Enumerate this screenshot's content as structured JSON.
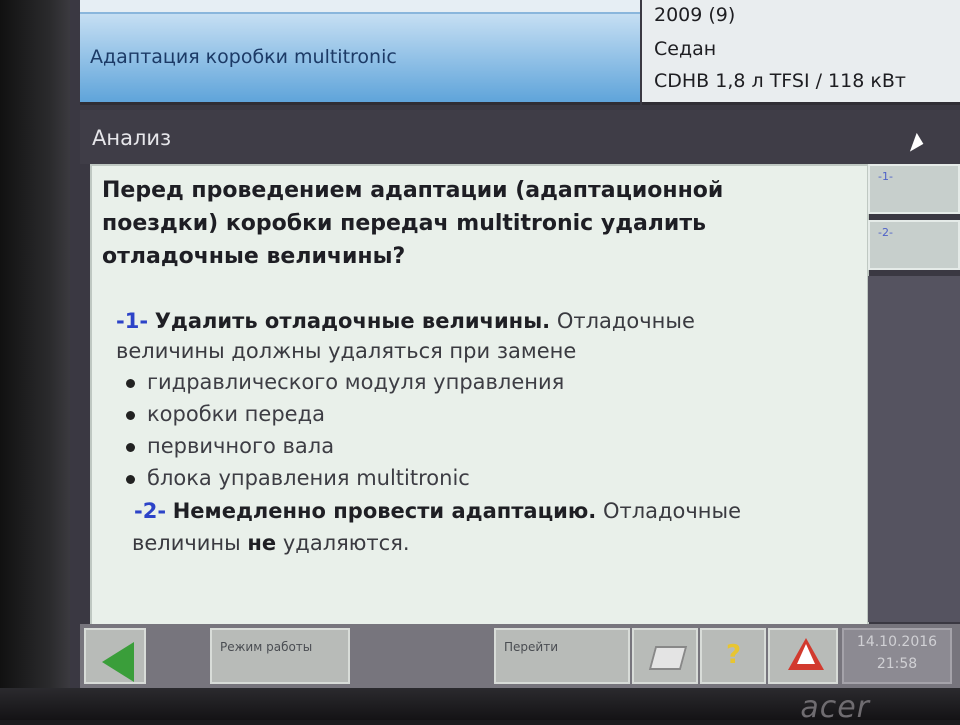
{
  "header": {
    "function_title": "Адаптация коробки multitronic",
    "vehicle": {
      "year": "2009 (9)",
      "body": "Седан",
      "engine": "CDHB 1,8 л TFSI / 118 кВт"
    }
  },
  "analysis": {
    "title": "Анализ",
    "question": "Перед проведением адаптации (адаптационной поездки) коробки передач multitronic удалить отладочные величины?",
    "option1": {
      "number": "-1-",
      "bold": "Удалить отладочные величины.",
      "line1_rest": "Отладочные",
      "line2": "величины должны удаляться при замене",
      "bullets": [
        "гидравлического модуля управления",
        "коробки переда",
        "первичного вала",
        "блока управления multitronic"
      ]
    },
    "option2": {
      "number": "-2-",
      "bold": "Немедленно провести адаптацию.",
      "line1_rest": "Отладочные",
      "line2_start": "величины",
      "line2_bold": "не",
      "line2_end": "удаляются."
    }
  },
  "side_buttons": [
    "-1-",
    "-2-"
  ],
  "toolbar": {
    "mode_label": "Режим работы",
    "goto_label": "Перейти",
    "help_symbol": "?",
    "date": "14.10.2016",
    "time": "21:58"
  },
  "brand": "acer",
  "colors": {
    "header_blue": "#5fa4da",
    "option_number": "#2c43c8",
    "back_arrow": "#3a9e3a",
    "warning": "#d23a2e"
  },
  "icons": [
    "back-arrow-icon",
    "printer-icon",
    "help-icon",
    "warning-icon",
    "mouse-cursor-icon"
  ]
}
